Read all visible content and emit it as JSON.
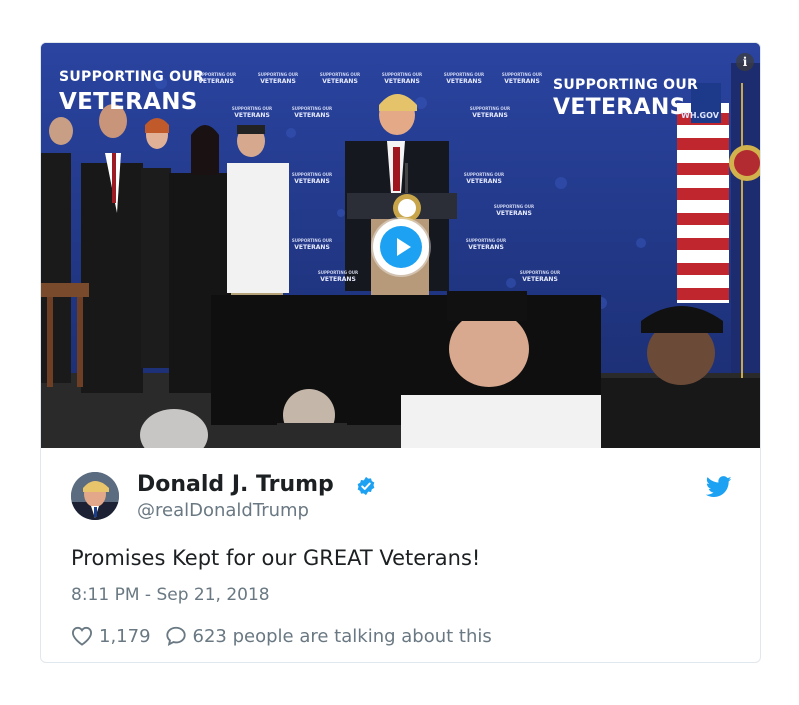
{
  "media": {
    "banner_small_top": "SUPPORTING OUR",
    "banner_large_top": "VETERANS",
    "tile_top": "SUPPORTING OUR",
    "tile_bottom": "VETERANS",
    "gov_text": "WH.GOV",
    "info_label": "i"
  },
  "tweet": {
    "display_name": "Donald J. Trump",
    "handle": "@realDonaldTrump",
    "text": "Promises Kept for our GREAT Veterans!",
    "timestamp": "8:11 PM - Sep 21, 2018",
    "likes": "1,179",
    "replies_text": "623 people are talking about this"
  },
  "colors": {
    "twitter_blue": "#1da1f2",
    "text_primary": "#1c2022",
    "text_secondary": "#697882",
    "border": "#e1e8ed",
    "banner_blue": "#233a8a"
  },
  "icons": {
    "verified": "verified-badge-icon",
    "brand": "twitter-bird-icon",
    "like": "heart-icon",
    "reply": "speech-bubble-icon",
    "play": "play-icon",
    "info": "info-icon"
  }
}
